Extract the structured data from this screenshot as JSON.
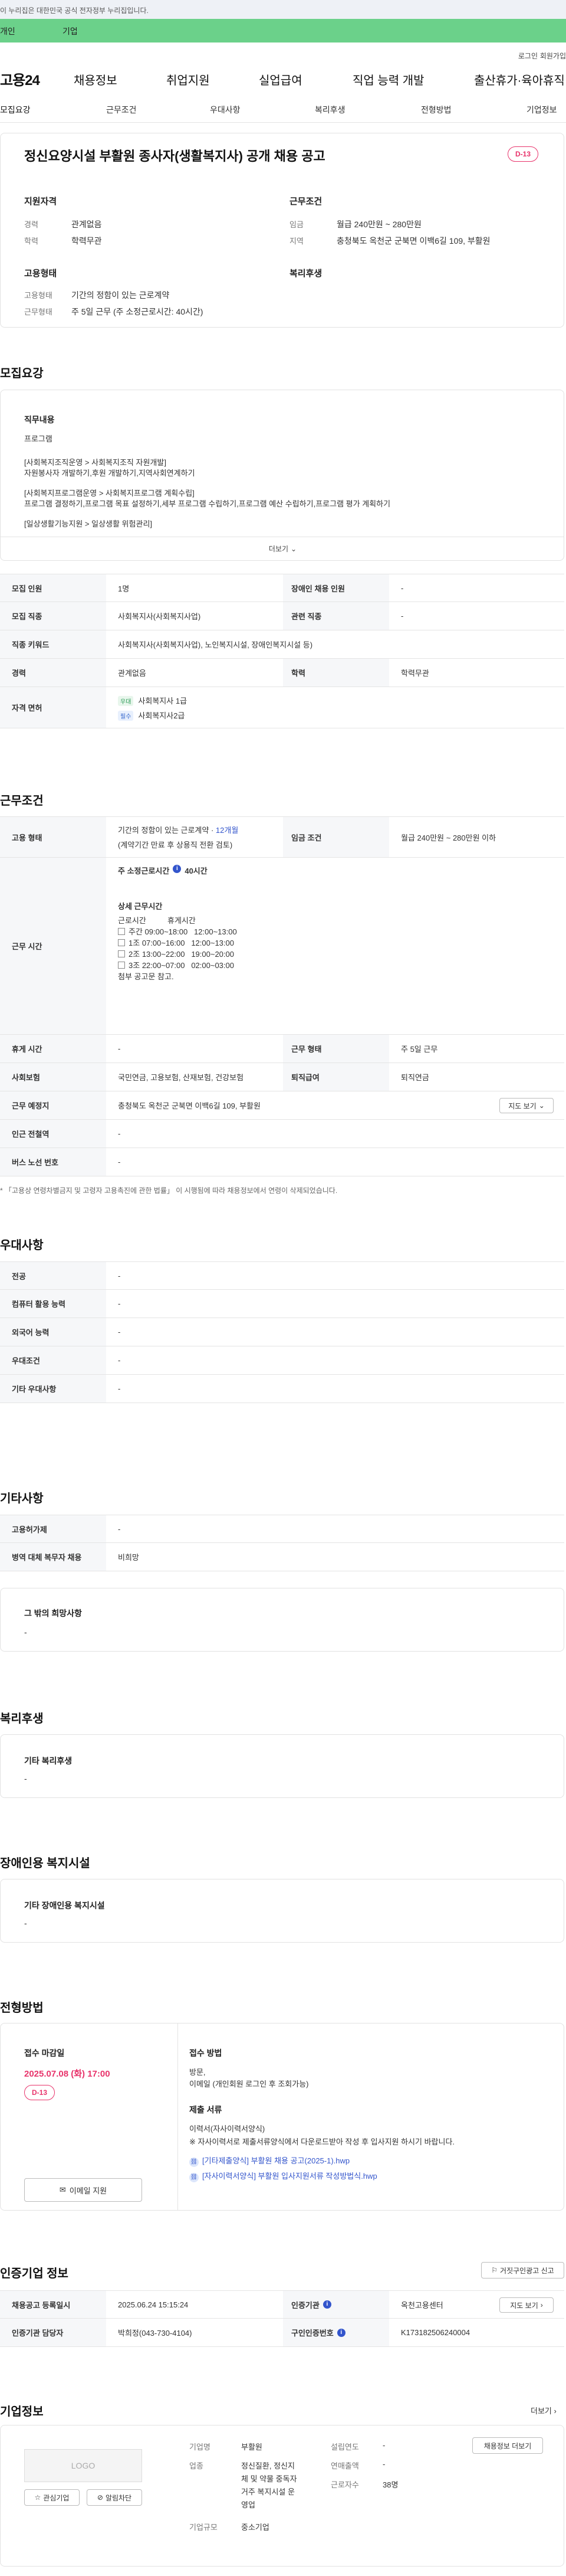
{
  "gov_banner": "이 누리집은 대한민국 공식 전자정부 누리집입니다.",
  "user_tabs": {
    "personal": "개인",
    "company": "기업"
  },
  "topbar": {
    "login": "로그인",
    "signup": "회원가입"
  },
  "gnb": {
    "logo": "고용24",
    "items": [
      "채용정보",
      "취업지원",
      "실업급여",
      "직업 능력 개발",
      "출산휴가·육아휴직"
    ]
  },
  "tabs": [
    "모집요강",
    "근무조건",
    "우대사항",
    "복리후생",
    "전형방법",
    "기업정보"
  ],
  "header": {
    "title": "정신요양시설 부활원 종사자(생활복지사) 공개 채용 공고",
    "dday": "D-13",
    "applicant_title": "지원자격",
    "career_label": "경력",
    "career_value": "관계없음",
    "edu_label": "학력",
    "edu_value": "학력무관",
    "work_title": "근무조건",
    "wage_label": "임금",
    "wage_value": "월급 240만원 ~ 280만원",
    "region_label": "지역",
    "region_value": "충청북도 옥천군 군북면 이백6길 109, 부활원",
    "emp_title": "고용형태",
    "emp_label": "고용형태",
    "emp_value": "기간의 정함이 있는 근로계약",
    "hours_label": "근무형태",
    "hours_value": "주 5일 근무 (주 소정근로시간: 40시간)",
    "welfare_title": "복리후생"
  },
  "recruit": {
    "section_title": "모집요강",
    "duty_title": "직무내용",
    "duty_lines": [
      "프로그램",
      "",
      "[사회복지조직운영 > 사회복지조직 자원개발]",
      "자원봉사자 개발하기,후원 개발하기,지역사회연계하기",
      "",
      "[사회복지프로그램운영 > 사회복지프로그램 계획수립]",
      "프로그램 결정하기,프로그램 목표 설정하기,세부 프로그램 수립하기,프로그램 예산 수립하기,프로그램 평가 계획하기",
      "",
      "[일상생활기능지원 > 일상생활 위험관리]"
    ],
    "more_label": "더보기",
    "rows": [
      {
        "th": "모집 인원",
        "td": "1명",
        "th2": "장애인 채용 인원",
        "td2": "-"
      },
      {
        "th": "모집 직종",
        "td": "사회복지사(사회복지사업)",
        "th2": "관련 직종",
        "td2": "-"
      },
      {
        "th": "직종 키워드",
        "td": "사회복지사(사회복지사업), 노인복지시설, 장애인복지시설 등)"
      },
      {
        "th": "경력",
        "td": "관계없음",
        "th2": "학력",
        "td2": "학력무관"
      }
    ],
    "license_label": "자격 면허",
    "licenses": [
      {
        "tag": "우대",
        "name": "사회복지사 1급"
      },
      {
        "tag": "필수",
        "name": "사회복지사2급"
      }
    ]
  },
  "work": {
    "section_title": "근무조건",
    "emp_label": "고용 형태",
    "emp_value_a": "기간의 정함이 있는 근로계약 · ",
    "emp_value_b": "12개월",
    "emp_note": "(계약기간 만료 후 상용직 전환 검토)",
    "wage_label": "임금 조건",
    "wage_value": "월급 240만원 ~ 280만원 이하",
    "time_label": "근무 시간",
    "weekly_hours": "주 소정근로시간",
    "weekly_hours_value": "40시간",
    "detail_title": "상세 근무시간",
    "col_work": "근로시간",
    "col_break": "휴게시간",
    "shifts": [
      {
        "name": "주간",
        "work": "09:00~18:00",
        "brk": "12:00~13:00"
      },
      {
        "name": "1조",
        "work": "07:00~16:00",
        "brk": "12:00~13:00"
      },
      {
        "name": "2조",
        "work": "13:00~22:00",
        "brk": "19:00~20:00"
      },
      {
        "name": "3조",
        "work": "22:00~07:00",
        "brk": "02:00~03:00"
      }
    ],
    "shift_note": "첨부 공고문 참고.",
    "rest_label": "휴게 시간",
    "rest_value": "-",
    "type_label": "근무 형태",
    "type_value": "주 5일 근무",
    "insurance_label": "사회보험",
    "insurance_value": "국민연금, 고용보험, 산재보험, 건강보험",
    "retire_label": "퇴직급여",
    "retire_value": "퇴직연금",
    "place_label": "근무 예정지",
    "place_value": "충청북도 옥천군 군북면 이백6길 109, 부활원",
    "map_button": "지도 보기",
    "subway_label": "인근 전철역",
    "subway_value": "-",
    "bus_label": "버스 노선 번호",
    "bus_value": "-",
    "footnote": "* 「고용상 연령차별금지 및 고령자 고용촉진에 관한 법률」 이 시행됨에 따라 채용정보에서 연령이 삭제되었습니다."
  },
  "pref": {
    "section_title": "우대사항",
    "rows": [
      {
        "th": "전공",
        "td": "-"
      },
      {
        "th": "컴퓨터 활용 능력",
        "td": "-"
      },
      {
        "th": "외국어 능력",
        "td": "-"
      },
      {
        "th": "우대조건",
        "td": "-"
      },
      {
        "th": "기타 우대사항",
        "td": "-"
      }
    ]
  },
  "etc": {
    "section_title": "기타사항",
    "rows": [
      {
        "th": "고용허가제",
        "td": "-"
      },
      {
        "th": "병역 대체 복무자 채용",
        "td": "비희망"
      }
    ],
    "other_title": "그 밖의 희망사항",
    "other_value": "-"
  },
  "benefit": {
    "section_title": "복리후생",
    "sub_title": "기타 복리후생",
    "value": "-"
  },
  "disabled": {
    "section_title": "장애인용 복지시설",
    "sub_title": "기타 장애인용 복지시설",
    "value": "-"
  },
  "selection": {
    "section_title": "전형방법",
    "deadline_title": "접수 마감일",
    "deadline_value": "2025.07.08 (화) 17:00",
    "dday": "D-13",
    "email_button": "이메일 지원",
    "method_title": "접수 방법",
    "method_line1": "방문,",
    "method_line2": "이메일 (개인회원 로그인 후 조회가능)",
    "docs_title": "제출 서류",
    "docs_line1": "이력서(자사이력서양식)",
    "docs_line2": "※ 자사이력서로 제출서류양식에서 다운로드받아 작성 후 입사지원 하시기 바랍니다.",
    "files": [
      "[기타제출양식] 부활원 채용 공고(2025-1).hwp",
      "[자사이력서양식] 부활원 입사지원서류 작성방법식.hwp"
    ]
  },
  "cert": {
    "section_title": "인증기업 정보",
    "report_button": "거짓구인광고 신고",
    "rows": [
      {
        "th": "채용공고 등록일시",
        "td": "2025.06.24 15:15:24",
        "th2": "인증기관",
        "td2": "옥천고용센터"
      },
      {
        "th": "인증기관 담당자",
        "td": "박희정(043-730-4104)",
        "th2": "구인인증번호",
        "td2": "K173182506240004"
      }
    ],
    "map_button": "지도 보기"
  },
  "company": {
    "section_title": "기업정보",
    "more": "더보기",
    "logo": "LOGO",
    "fav_button": "관심기업",
    "alarm_button": "알림차단",
    "name_label": "기업명",
    "name_value": "부활원",
    "industry_label": "업종",
    "industry_lines": [
      "정신질환, 정신지",
      "체 및 약물 중독자",
      "거주 복지시설 운",
      "영업"
    ],
    "scale_label": "기업규모",
    "scale_value": "중소기업",
    "founded_label": "설립연도",
    "founded_value": "-",
    "revenue_label": "연매출액",
    "revenue_value": "-",
    "staff_label": "근로자수",
    "staff_value": "38명",
    "view_button": "채용정보 더보기"
  }
}
